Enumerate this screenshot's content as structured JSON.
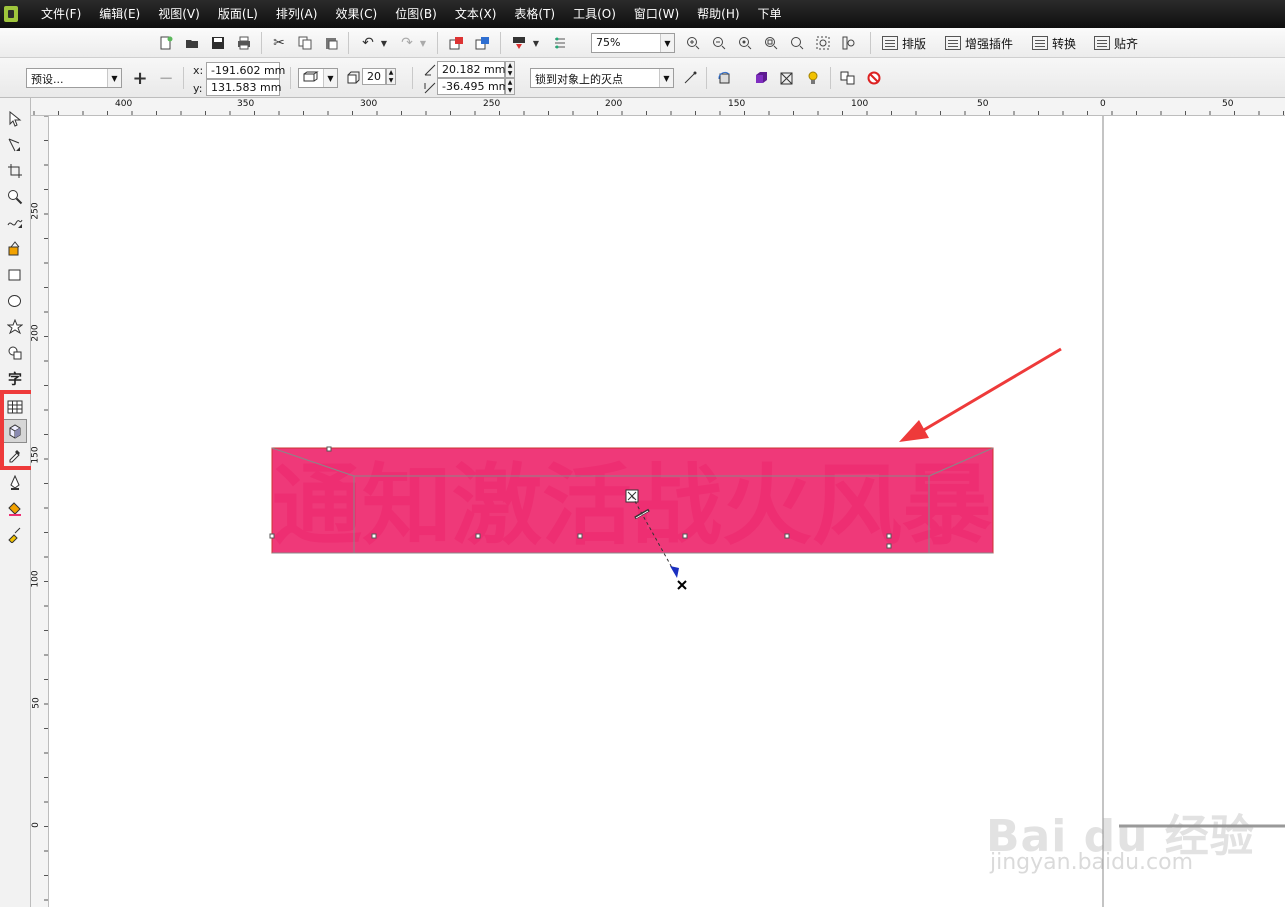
{
  "menubar": {
    "items": [
      "文件(F)",
      "编辑(E)",
      "视图(V)",
      "版面(L)",
      "排列(A)",
      "效果(C)",
      "位图(B)",
      "文本(X)",
      "表格(T)",
      "工具(O)",
      "窗口(W)",
      "帮助(H)",
      "下单"
    ]
  },
  "toolbar": {
    "zoom": "75%",
    "plugin_buttons": [
      "排版",
      "增强插件",
      "转换",
      "贴齐"
    ]
  },
  "property_bar": {
    "preset": "预设...",
    "x_label": "x:",
    "x_value": "-191.602 mm",
    "y_label": "y:",
    "y_value": "131.583 mm",
    "depth_value": "20",
    "vp_x_value": "20.182 mm",
    "vp_y_value": "-36.495 mm",
    "vanishing_point_mode": "锁到对象上的灭点"
  },
  "rulers": {
    "top_labels": [
      "400",
      "350",
      "300",
      "250",
      "200",
      "150",
      "100",
      "50",
      "0",
      "50"
    ],
    "left_labels": [
      "250",
      "200",
      "150",
      "100",
      "50",
      "0"
    ]
  },
  "canvas": {
    "extruded_text": "通知激活战火风暴",
    "text_color": "#ee2e72",
    "annotation_color": "#ee3a3a"
  },
  "watermark": {
    "logo": "Bai du 经验",
    "url": "jingyan.baidu.com"
  }
}
